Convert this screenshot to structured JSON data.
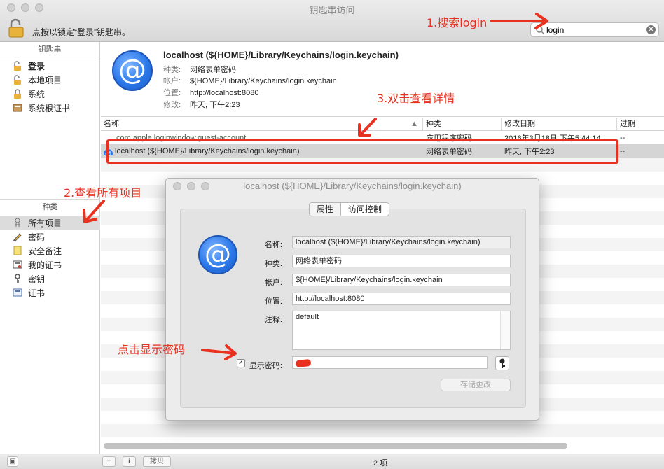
{
  "window": {
    "title": "钥匙串访问",
    "lock_text": "点按以锁定“登录”钥匙串。"
  },
  "search": {
    "value": "login",
    "clear_glyph": "✕"
  },
  "sidebar": {
    "keychains_header": "钥匙串",
    "keychains": [
      {
        "label": "登录",
        "icon": "unlocked-padlock-icon"
      },
      {
        "label": "本地项目",
        "icon": "unlocked-padlock-icon"
      },
      {
        "label": "系统",
        "icon": "padlock-icon"
      },
      {
        "label": "系统根证书",
        "icon": "certificate-cabinet-icon"
      }
    ],
    "categories_header": "种类",
    "categories": [
      {
        "label": "所有项目",
        "icon": "all-items-icon"
      },
      {
        "label": "密码",
        "icon": "password-pencil-icon"
      },
      {
        "label": "安全备注",
        "icon": "note-icon"
      },
      {
        "label": "我的证书",
        "icon": "my-certificate-icon"
      },
      {
        "label": "密钥",
        "icon": "key-icon"
      },
      {
        "label": "证书",
        "icon": "certificate-icon"
      }
    ]
  },
  "detail": {
    "icon_glyph": "@",
    "title": "localhost (${HOME}/Library/Keychains/login.keychain)",
    "rows": [
      {
        "key": "种类:",
        "value": "网络表单密码"
      },
      {
        "key": "帐户:",
        "value": "${HOME}/Library/Keychains/login.keychain"
      },
      {
        "key": "位置:",
        "value": "http://localhost:8080"
      },
      {
        "key": "修改:",
        "value": "昨天, 下午2:23"
      }
    ]
  },
  "list": {
    "columns": [
      "名称",
      "种类",
      "修改日期",
      "过期"
    ],
    "rows": [
      {
        "name": "com.apple.loginwindow.guest-account",
        "kind": "应用程序密码",
        "date": "2016年3月18日 下午5:44:14",
        "expires": "--"
      },
      {
        "name": "localhost (${HOME}/Library/Keychains/login.keychain)",
        "kind": "网络表单密码",
        "date": "昨天, 下午2:23",
        "expires": "--"
      }
    ]
  },
  "bottom": {
    "copy_label": "拷贝",
    "count": "2 项",
    "add_glyph": "+",
    "info_glyph": "i"
  },
  "inspector": {
    "title": "localhost (${HOME}/Library/Keychains/login.keychain)",
    "tabs": [
      "属性",
      "访问控制"
    ],
    "icon_glyph": "@",
    "fields": {
      "name_label": "名称:",
      "name_value": "localhost (${HOME}/Library/Keychains/login.keychain)",
      "kind_label": "种类:",
      "kind_value": "网络表单密码",
      "account_label": "帐户:",
      "account_value": "${HOME}/Library/Keychains/login.keychain",
      "where_label": "位置:",
      "where_value": "http://localhost:8080",
      "comment_label": "注释:",
      "comment_value": "default",
      "show_password_label": "显示密码:",
      "show_password_checked": "✓"
    },
    "save_label": "存储更改"
  },
  "annotations": {
    "step1": "1.搜索login",
    "step2": "2.查看所有项目",
    "step3": "3.双击查看详情",
    "step4": "点击显示密码",
    "color": "#e8321f"
  }
}
